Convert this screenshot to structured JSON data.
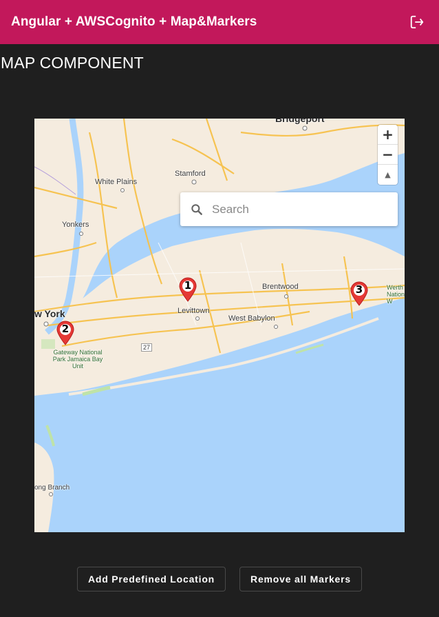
{
  "app": {
    "title": "Angular + AWSCognito + Map&Markers",
    "logout_icon": "logout-icon",
    "accent_color": "#c2185b"
  },
  "page": {
    "heading": "MAP COMPONENT"
  },
  "map": {
    "search_placeholder": "Search",
    "zoom_in": "+",
    "zoom_out": "−",
    "compass": "▲",
    "labels": {
      "bridgeport": "Bridgeport",
      "stamford": "Stamford",
      "white_plains": "White Plains",
      "yonkers": "Yonkers",
      "brentwood": "Brentwood",
      "levittown": "Levittown",
      "west_babylon": "West Babylon",
      "new_york": "w York",
      "gateway": "Gateway National Park Jamaica Bay Unit",
      "route": "27",
      "long_branch": "ong Branch",
      "worth": "Werth National W"
    },
    "markers": [
      {
        "label": "1"
      },
      {
        "label": "2"
      },
      {
        "label": "3"
      }
    ]
  },
  "actions": {
    "add_label": "Add Predefined Location",
    "remove_label": "Remove all Markers"
  }
}
